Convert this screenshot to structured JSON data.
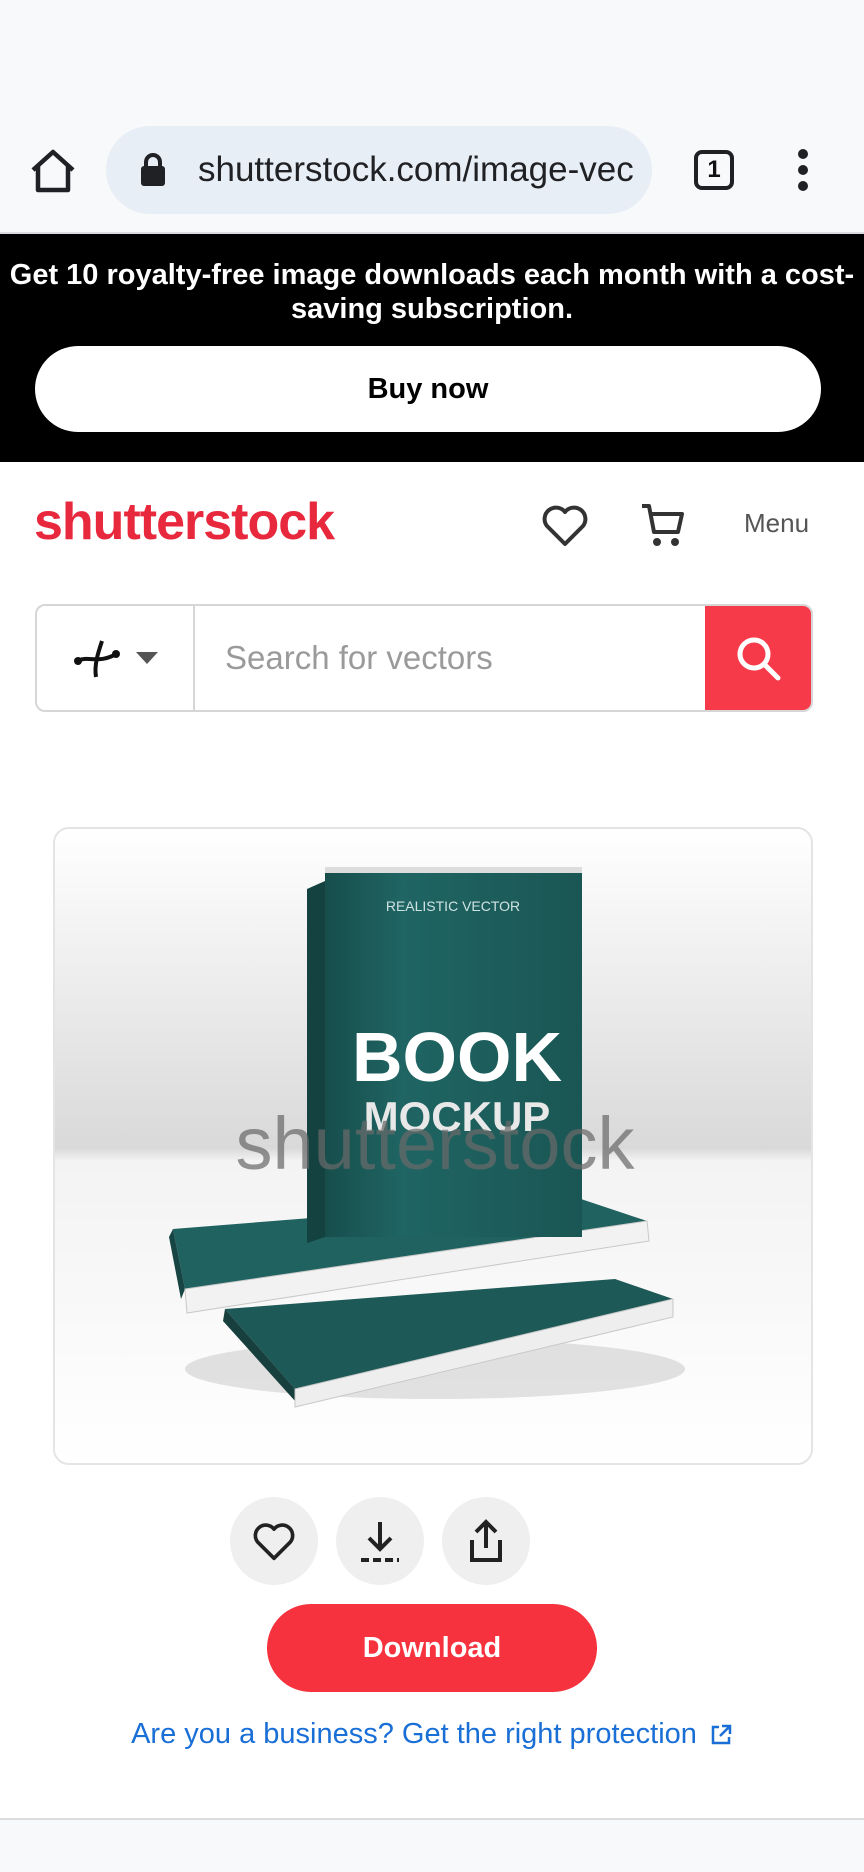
{
  "browser": {
    "url": "shutterstock.com/image-vec",
    "tab_count": "1"
  },
  "promo": {
    "text": "Get 10 royalty-free image downloads each month with a cost-saving subscription.",
    "button_label": "Buy now"
  },
  "header": {
    "logo": "shutterstock",
    "menu_label": "Menu"
  },
  "search": {
    "placeholder": "Search for vectors",
    "asset_type_icon": "vector-curve-icon"
  },
  "preview": {
    "book_top_text": "REALISTIC VECTOR",
    "book_title_line1": "BOOK",
    "book_title_line2": "MOCKUP",
    "watermark": "shutterstock"
  },
  "actions": {
    "download_label": "Download",
    "business_link": "Are you a business? Get the right protection"
  },
  "colors": {
    "brand_red": "#e8283d",
    "download_red": "#f7323f",
    "link_blue": "#1a6fd6",
    "book_teal": "#1f5f5c"
  }
}
